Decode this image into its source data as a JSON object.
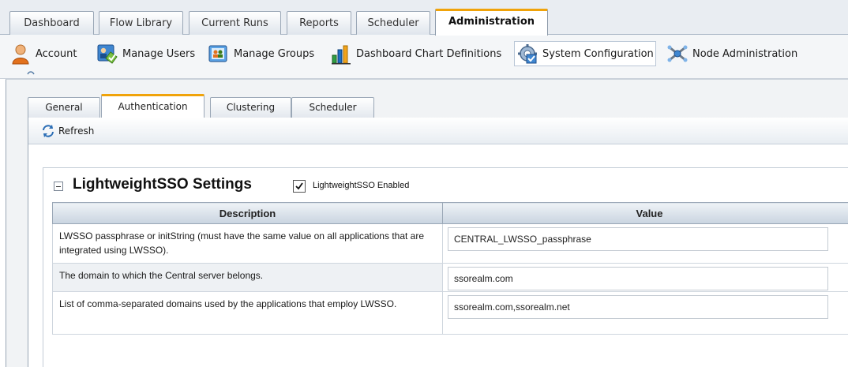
{
  "top_tabs": [
    {
      "label": "Dashboard"
    },
    {
      "label": "Flow Library"
    },
    {
      "label": "Current Runs"
    },
    {
      "label": "Reports"
    },
    {
      "label": "Scheduler"
    },
    {
      "label": "Administration",
      "active": true
    }
  ],
  "toolbar": {
    "items": [
      {
        "label": "Account",
        "icon": "account-icon"
      },
      {
        "label": "Manage Users",
        "icon": "manage-users-icon"
      },
      {
        "label": "Manage Groups",
        "icon": "manage-groups-icon"
      },
      {
        "label": "Dashboard Chart Definitions",
        "icon": "chart-icon"
      },
      {
        "label": "System Configuration",
        "icon": "system-configuration-icon",
        "active": true
      },
      {
        "label": "Node Administration",
        "icon": "node-administration-icon"
      }
    ]
  },
  "sub_tabs": [
    {
      "label": "General"
    },
    {
      "label": "Authentication",
      "active": true
    },
    {
      "label": "Clustering"
    },
    {
      "label": "Scheduler"
    }
  ],
  "refresh": {
    "label": "Refresh",
    "icon": "refresh-icon"
  },
  "section": {
    "title": "LightweightSSO Settings",
    "enabled_checked": true,
    "enabled_label": "LightweightSSO Enabled",
    "collapse_icon": "collapse-icon"
  },
  "table": {
    "columns": [
      "Description",
      "Value"
    ],
    "rows": [
      {
        "description": "LWSSO passphrase or initString (must have the same value on all applications that are integrated using LWSSO).",
        "value": "CENTRAL_LWSSO_passphrase"
      },
      {
        "description": "The domain to which the Central server belongs.",
        "value": "ssorealm.com"
      },
      {
        "description": "List of comma-separated domains used by the applications that employ LWSSO.",
        "value": "ssorealm.com,ssorealm.net"
      }
    ]
  },
  "colors": {
    "active_tab_accent": "#f0a30a",
    "header_gradient_end": "#c9d4e0",
    "frame_border": "#9aa7b6"
  }
}
